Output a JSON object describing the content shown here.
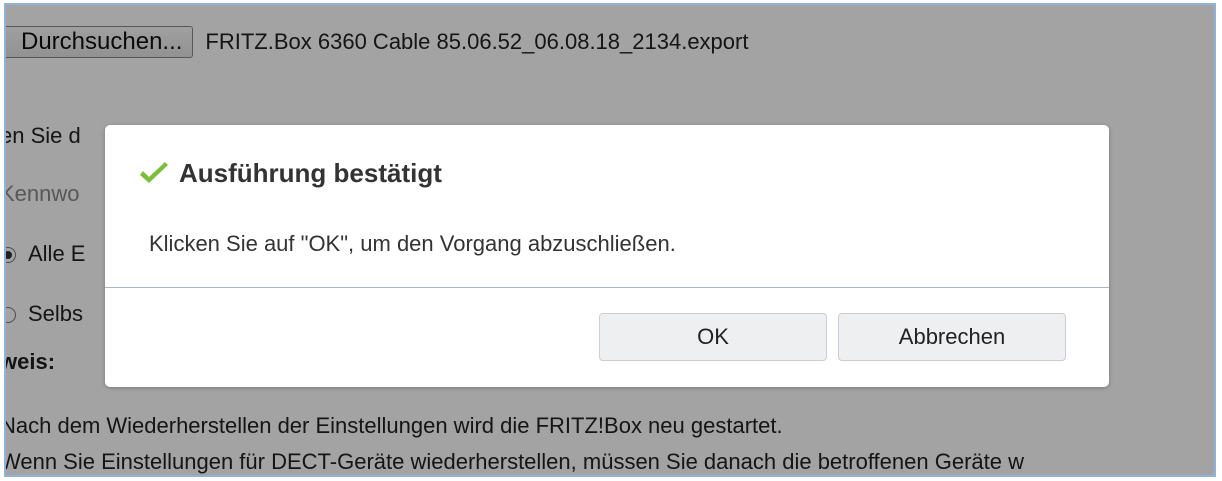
{
  "browse": {
    "button_label": "Durchsuchen...",
    "file_name": "FRITZ.Box 6360 Cable 85.06.52_06.08.18_2134.export"
  },
  "background": {
    "line_instruction": "en Sie d",
    "line_password": "Kennwo",
    "radio_all": "Alle E",
    "radio_select": "Selbs",
    "hint_label": "weis:",
    "note_restart": "Nach dem Wiederherstellen der Einstellungen wird die FRITZ!Box neu gestartet.",
    "note_dect": "Wenn Sie Einstellungen für DECT-Geräte wiederherstellen, müssen Sie danach die betroffenen Geräte w"
  },
  "dialog": {
    "icon": "checkmark-icon",
    "title": "Ausführung bestätigt",
    "message": "Klicken Sie auf \"OK\", um den Vorgang abzuschließen.",
    "ok_label": "OK",
    "cancel_label": "Abbrechen",
    "check_color": "#7dbd3c"
  }
}
